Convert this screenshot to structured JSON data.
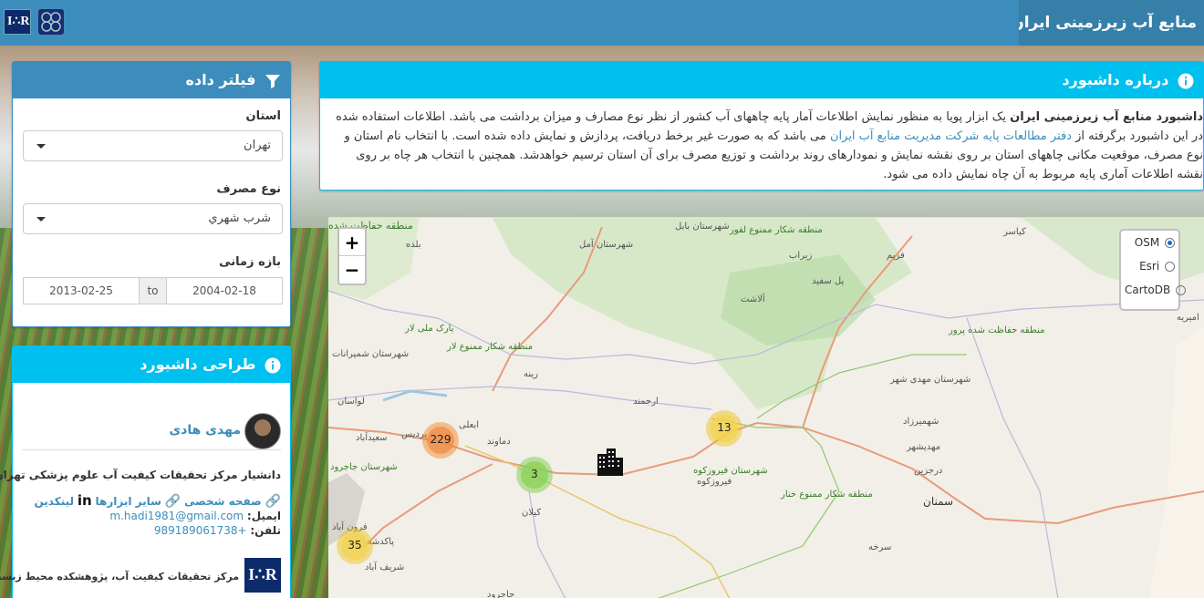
{
  "header": {
    "title": "منابع آب زیرزمینی ایران",
    "logo_text": "I∴R"
  },
  "filter": {
    "title": "فیلتر داده",
    "province_label": "استان",
    "province_value": "تهران",
    "usage_label": "نوع مصرف",
    "usage_value": "شرب شهري",
    "period_label": "بازه زمانی",
    "date_start": "2013-02-25",
    "date_sep": "to",
    "date_end": "2004-02-18"
  },
  "design": {
    "title": "طراحی داشبورد",
    "person_name": "مهدی هادی",
    "affiliation": "دانشیار مرکز تحقیقات کیفیت آب علوم پزشکی تهران",
    "link_homepage": "صفحه شخصی",
    "link_tools": "سایر ابزارها",
    "link_linkedin": "لینکدین",
    "email_label": "ایمیل:",
    "email_value": "m.hadi1981@gmail.com",
    "phone_label": "تلفن:",
    "phone_value": "+989189061738",
    "org_name": "مرکز تحقیقات کیفیت آب، پژوهشکده محیط زیست"
  },
  "about": {
    "title": "درباره داشبورد",
    "bold_lead": "داشبورد منابع آب زیرزمینی ایران",
    "text_1": " یک ابزار پویا به منظور نمایش اطلاعات آمار پایه چاههای آب کشور از نظر نوع مصارف و میزان برداشت می باشد. اطلاعات استفاده شده در این داشبورد برگرفته از ",
    "link": "دفتر مطالعات پایه شرکت مدیریت منابع آب ایران",
    "text_2": " می باشد که به صورت غیر برخط دریافت، پردازش و نمایش داده شده است. با انتخاب نام استان و نوع مصرف، موقعیت مکانی چاههای استان بر روی نقشه نمایش و نمودارهای روند برداشت و توزیع مصرف برای آن استان ترسیم خواهدشد. همچنین با انتخاب هر چاه بر روی نقشه اطلاعات آماری پایه مربوط به آن چاه نمایش داده می شود."
  },
  "map": {
    "zoom_in": "+",
    "zoom_out": "−",
    "layers": [
      "OSM",
      "Esri",
      "CartoDB"
    ],
    "selected_layer": "OSM",
    "clusters": [
      {
        "count": "229",
        "color": "orange"
      },
      {
        "count": "13",
        "color": "yellow"
      },
      {
        "count": "3",
        "color": "green"
      },
      {
        "count": "35",
        "color": "yellow"
      }
    ],
    "places": [
      "منطقه حفاظت شده",
      "شهرستان بابل",
      "منطقه شکار ممنوع لفور",
      "کیاسر",
      "بلده",
      "شهرستان آمل",
      "زیراب",
      "فریم",
      "پل سفید",
      "آلاشت",
      "امیریه",
      "پارک ملی لار",
      "منطقه شکار ممنوع لار",
      "شهرستان شمیرانات",
      "رینه",
      "منطقه حفاظت شده پرور",
      "شهرستان مهدی شهر",
      "لواسان",
      "ارجمند",
      "ابعلی",
      "پردیس",
      "سعیدآباد",
      "دماوند",
      "فیروزکوه",
      "شهرستان فیروزکوه",
      "شهمیرزاد",
      "مهدیشهر",
      "درجزین",
      "منطقه شکار ممنوع خنار",
      "سمنان",
      "کیلان",
      "سرخه",
      "شهرستان جاجرود",
      "فرون آباد",
      "پاکدشت",
      "شریف آباد",
      "جاجرود"
    ]
  },
  "colors": {
    "primary": "#3c8dbc",
    "info": "#00c0ef",
    "brand_dark": "#367fa9"
  }
}
